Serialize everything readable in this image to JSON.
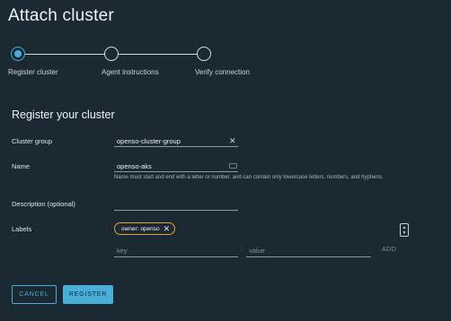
{
  "page": {
    "title": "Attach cluster"
  },
  "stepper": {
    "steps": [
      {
        "label": "Register cluster",
        "state": "active"
      },
      {
        "label": "Agent instructions",
        "state": "pending"
      },
      {
        "label": "Verify connection",
        "state": "pending"
      }
    ]
  },
  "form": {
    "section_title": "Register your cluster",
    "cluster_group": {
      "label": "Cluster group",
      "value": "openso-cluster-group",
      "clear_icon": "close-icon"
    },
    "name": {
      "label": "Name",
      "value": "openso-aks",
      "helper": "Name must start and end with a letter or number, and can contain only lowercase letters, numbers, and hyphens."
    },
    "description": {
      "label": "Description (optional)",
      "value": ""
    },
    "labels": {
      "label": "Labels",
      "chips": [
        {
          "text": "owner: openso"
        }
      ],
      "key_placeholder": "key",
      "separator": ":",
      "value_placeholder": "value",
      "add_label": "ADD"
    }
  },
  "actions": {
    "cancel_label": "CANCEL",
    "register_label": "REGISTER"
  },
  "colors": {
    "accent": "#49afd9",
    "background": "#1b2a32",
    "chip_border": "#e0a135"
  }
}
